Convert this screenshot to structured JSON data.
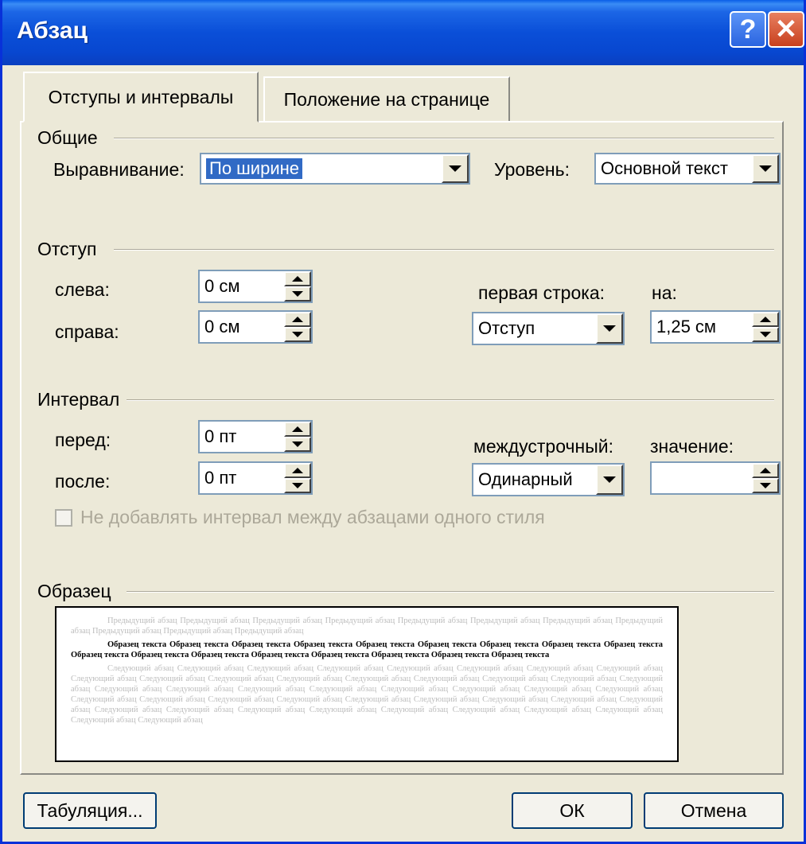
{
  "window": {
    "title": "Абзац",
    "help_label": "?",
    "close_label": "✕"
  },
  "tabs": [
    {
      "label": "Отступы и интервалы",
      "active": true
    },
    {
      "label": "Положение на странице",
      "active": false
    }
  ],
  "general": {
    "group_label": "Общие",
    "alignment_label": "Выравнивание:",
    "alignment_value": "По ширине",
    "level_label": "Уровень:",
    "level_value": "Основной текст"
  },
  "indent": {
    "group_label": "Отступ",
    "left_label": "слева:",
    "left_value": "0 см",
    "right_label": "справа:",
    "right_value": "0 см",
    "first_line_label": "первая строка:",
    "first_line_value": "Отступ",
    "by_label": "на:",
    "by_value": "1,25 см"
  },
  "spacing": {
    "group_label": "Интервал",
    "before_label": "перед:",
    "before_value": "0 пт",
    "after_label": "после:",
    "after_value": "0 пт",
    "line_spacing_label": "междустрочный:",
    "line_spacing_value": "Одинарный",
    "at_label": "значение:",
    "at_value": "",
    "no_space_same_style_label": "Не добавлять интервал между абзацами одного стиля",
    "no_space_same_style_checked": false
  },
  "preview": {
    "group_label": "Образец",
    "previous_text": "Предыдущий абзац Предыдущий абзац Предыдущий абзац Предыдущий абзац Предыдущий абзац Предыдущий абзац Предыдущий абзац Предыдущий абзац Предыдущий абзац Предыдущий абзац Предыдущий абзац",
    "sample_text": "Образец текста Образец текста Образец текста Образец текста Образец текста Образец текста Образец текста Образец текста Образец текста Образец текста Образец текста Образец текста Образец текста Образец текста Образец текста Образец текста Образец текста",
    "next_text": "Следующий абзац Следующий абзац Следующий абзац Следующий абзац Следующий абзац Следующий абзац Следующий абзац Следующий абзац Следующий абзац Следующий абзац Следующий абзац Следующий абзац Следующий абзац Следующий абзац Следующий абзац Следующий абзац Следующий абзац Следующий абзац Следующий абзац Следующий абзац Следующий абзац Следующий абзац Следующий абзац Следующий абзац Следующий абзац Следующий абзац Следующий абзац Следующий абзац Следующий абзац Следующий абзац Следующий абзац Следующий абзац Следующий абзац Следующий абзац Следующий абзац Следующий абзац Следующий абзац Следующий абзац Следующий абзац Следующий абзац Следующий абзац Следующий абзац Следующий абзац Следующий абзац"
  },
  "buttons": {
    "tabs_label": "Табуляция...",
    "ok_label": "ОК",
    "cancel_label": "Отмена"
  }
}
